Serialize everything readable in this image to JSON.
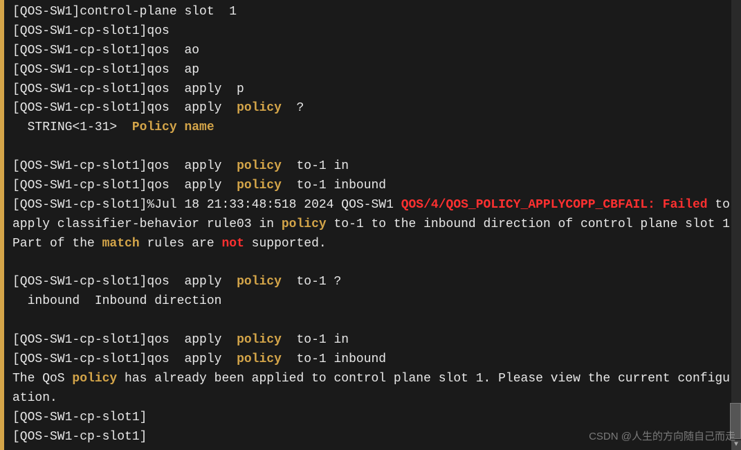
{
  "lines": [
    {
      "segments": [
        {
          "t": "[QOS-SW1]control-plane slot  1"
        }
      ]
    },
    {
      "segments": [
        {
          "t": "[QOS-SW1-cp-slot1]qos"
        }
      ]
    },
    {
      "segments": [
        {
          "t": "[QOS-SW1-cp-slot1]qos  ao"
        }
      ]
    },
    {
      "segments": [
        {
          "t": "[QOS-SW1-cp-slot1]qos  ap"
        }
      ]
    },
    {
      "segments": [
        {
          "t": "[QOS-SW1-cp-slot1]qos  apply  p"
        }
      ]
    },
    {
      "segments": [
        {
          "t": "[QOS-SW1-cp-slot1]qos  apply  "
        },
        {
          "t": "policy",
          "c": "kw"
        },
        {
          "t": "  ?"
        }
      ]
    },
    {
      "segments": [
        {
          "t": "  STRING<1-31>  "
        },
        {
          "t": "Policy name",
          "c": "kw"
        }
      ]
    },
    {
      "segments": [
        {
          "t": ""
        }
      ]
    },
    {
      "segments": [
        {
          "t": "[QOS-SW1-cp-slot1]qos  apply  "
        },
        {
          "t": "policy",
          "c": "kw"
        },
        {
          "t": "  to-1 in"
        }
      ]
    },
    {
      "segments": [
        {
          "t": "[QOS-SW1-cp-slot1]qos  apply  "
        },
        {
          "t": "policy",
          "c": "kw"
        },
        {
          "t": "  to-1 inbound"
        }
      ]
    },
    {
      "segments": [
        {
          "t": "[QOS-SW1-cp-slot1]%Jul 18 21:33:48:518 2024 QOS-SW1 "
        },
        {
          "t": "QOS/4/QOS_POLICY_APPLYCOPP_CBFAIL: Failed",
          "c": "err"
        },
        {
          "t": " to apply classifier-behavior rule03 in "
        },
        {
          "t": "policy",
          "c": "kw"
        },
        {
          "t": " to-1 to the inbound direction of control plane slot 1. Part of the "
        },
        {
          "t": "match",
          "c": "kw"
        },
        {
          "t": " rules are "
        },
        {
          "t": "not",
          "c": "err"
        },
        {
          "t": " supported."
        }
      ]
    },
    {
      "segments": [
        {
          "t": ""
        }
      ]
    },
    {
      "segments": [
        {
          "t": "[QOS-SW1-cp-slot1]qos  apply  "
        },
        {
          "t": "policy",
          "c": "kw"
        },
        {
          "t": "  to-1 ?"
        }
      ]
    },
    {
      "segments": [
        {
          "t": "  inbound  Inbound direction"
        }
      ]
    },
    {
      "segments": [
        {
          "t": ""
        }
      ]
    },
    {
      "segments": [
        {
          "t": "[QOS-SW1-cp-slot1]qos  apply  "
        },
        {
          "t": "policy",
          "c": "kw"
        },
        {
          "t": "  to-1 in"
        }
      ]
    },
    {
      "segments": [
        {
          "t": "[QOS-SW1-cp-slot1]qos  apply  "
        },
        {
          "t": "policy",
          "c": "kw"
        },
        {
          "t": "  to-1 inbound"
        }
      ]
    },
    {
      "segments": [
        {
          "t": "The QoS "
        },
        {
          "t": "policy",
          "c": "kw"
        },
        {
          "t": " has already been applied to control plane slot 1. Please view the current configuration."
        }
      ]
    },
    {
      "segments": [
        {
          "t": "[QOS-SW1-cp-slot1]"
        }
      ]
    },
    {
      "segments": [
        {
          "t": "[QOS-SW1-cp-slot1]"
        }
      ]
    }
  ],
  "watermark": "CSDN @人生的方向随自己而走"
}
